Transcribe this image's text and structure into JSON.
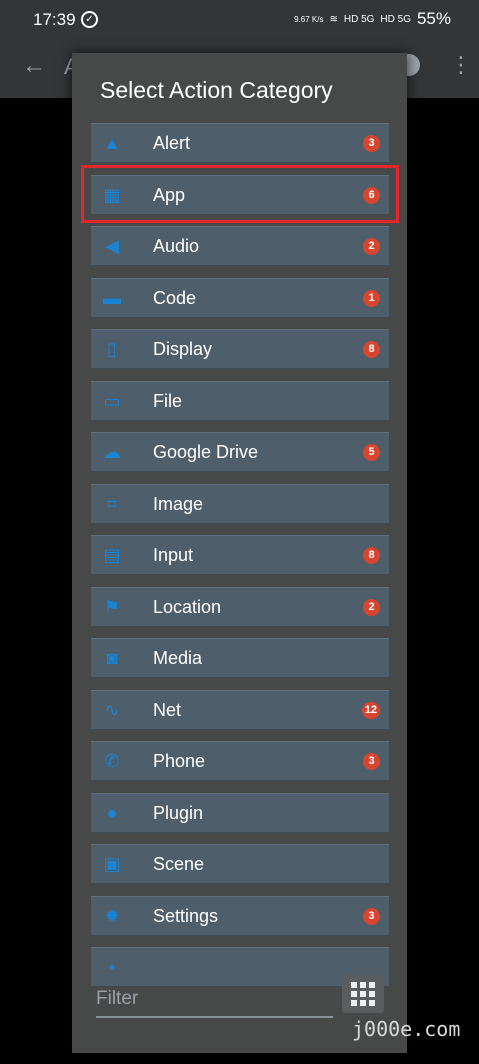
{
  "status": {
    "time": "17:39",
    "speed": "9.67 K/s",
    "network1": "HD 5G",
    "network2": "HD 5G",
    "battery": "55%"
  },
  "appbar": {
    "back_icon": "arrow-left-icon",
    "peek": "A"
  },
  "dialog": {
    "title": "Select Action Category",
    "items": [
      {
        "label": "Alert",
        "icon": "warning-icon",
        "badge": "3"
      },
      {
        "label": "App",
        "icon": "apps-icon",
        "badge": "6"
      },
      {
        "label": "Audio",
        "icon": "speaker-icon",
        "badge": "2"
      },
      {
        "label": "Code",
        "icon": "code-icon",
        "badge": "1"
      },
      {
        "label": "Display",
        "icon": "phone-display-icon",
        "badge": "8"
      },
      {
        "label": "File",
        "icon": "folder-icon",
        "badge": ""
      },
      {
        "label": "Google Drive",
        "icon": "cloud-icon",
        "badge": "5"
      },
      {
        "label": "Image",
        "icon": "crop-icon",
        "badge": ""
      },
      {
        "label": "Input",
        "icon": "keypad-icon",
        "badge": "8"
      },
      {
        "label": "Location",
        "icon": "flag-icon",
        "badge": "2"
      },
      {
        "label": "Media",
        "icon": "camera-icon",
        "badge": ""
      },
      {
        "label": "Net",
        "icon": "signal-icon",
        "badge": "12"
      },
      {
        "label": "Phone",
        "icon": "phone-icon",
        "badge": "3"
      },
      {
        "label": "Plugin",
        "icon": "plug-icon",
        "badge": ""
      },
      {
        "label": "Scene",
        "icon": "scene-icon",
        "badge": ""
      },
      {
        "label": "Settings",
        "icon": "gear-icon",
        "badge": "3"
      },
      {
        "label": "",
        "icon": "partial-icon",
        "badge": ""
      }
    ],
    "filter_placeholder": "Filter",
    "grid_icon": "grid-icon"
  },
  "watermark": "j000e.com",
  "colors": {
    "item_bg": "#4e5e6b",
    "icon": "#1a83d2",
    "badge": "#d8452f",
    "highlight": "#e3252e"
  }
}
